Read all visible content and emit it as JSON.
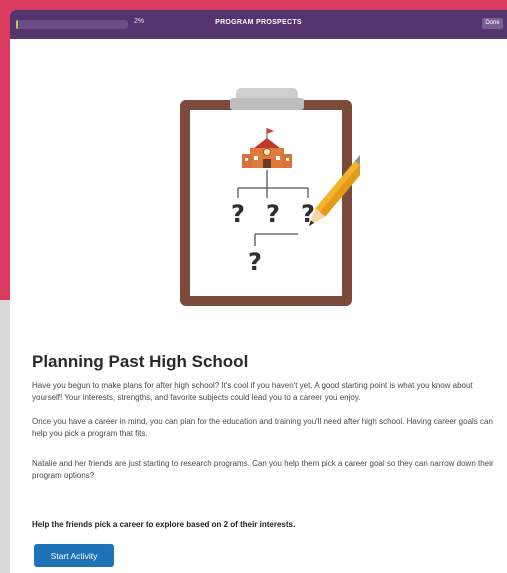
{
  "topbar": {
    "progress_percent": 2,
    "progress_label": "2%",
    "title": "PROGRAM PROSPECTS",
    "done_label": "Done"
  },
  "illustration": {
    "question_marks": [
      "?",
      "?",
      "?",
      "?"
    ]
  },
  "main": {
    "heading": "Planning Past High School",
    "paragraphs": [
      "Have you begun to make plans for after high school? It's cool if you haven't yet. A good starting point is what you know about yourself! Your interests, strengths, and favorite subjects could lead you to a career you enjoy.",
      "Once you have a career in mind, you can plan for the education and training you'll need after high school. Having career goals can help you pick a program that fits.",
      "Natalie and her friends are just starting to research programs. Can you help them pick a career goal so they can narrow down their program options?"
    ],
    "instruction": "Help the friends pick a career to explore based on 2 of their interests.",
    "start_button_label": "Start Activity"
  },
  "colors": {
    "topbar": "#55336e",
    "progress_fill": "#b9d44b",
    "button": "#1e73b8",
    "accent_background": "#d93a5e",
    "clipboard": "#7b4a3a"
  }
}
